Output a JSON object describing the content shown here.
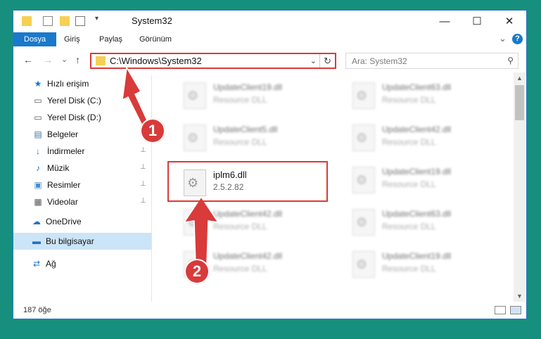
{
  "window": {
    "title": "System32",
    "minimize": "—",
    "maximize": "☐",
    "close": "✕"
  },
  "ribbon": {
    "tabs": [
      {
        "label": "Dosya"
      },
      {
        "label": "Giriş"
      },
      {
        "label": "Paylaş"
      },
      {
        "label": "Görünüm"
      }
    ],
    "expand_icon": "⌄",
    "help_icon": "?"
  },
  "nav": {
    "back_icon": "←",
    "forward_icon": "→",
    "recent_icon": "⌄",
    "up_icon": "↑",
    "address": "C:\\Windows\\System32",
    "address_dropdown": "⌄",
    "refresh_icon": "↻",
    "search_placeholder": "Ara: System32",
    "search_icon": "⚲"
  },
  "sidebar": {
    "items": [
      {
        "label": "Hızlı erişim",
        "icon": "star-icon",
        "glyph": "★",
        "pinned": false
      },
      {
        "label": "Yerel Disk (C:)",
        "icon": "drive-icon",
        "glyph": "▭",
        "pinned": false
      },
      {
        "label": "Yerel Disk (D:)",
        "icon": "drive-icon",
        "glyph": "▭",
        "pinned": false
      },
      {
        "label": "Belgeler",
        "icon": "documents-icon",
        "glyph": "▤",
        "pinned": true
      },
      {
        "label": "İndirmeler",
        "icon": "download-icon",
        "glyph": "↓",
        "pinned": true
      },
      {
        "label": "Müzik",
        "icon": "music-icon",
        "glyph": "♪",
        "pinned": true
      },
      {
        "label": "Resimler",
        "icon": "pictures-icon",
        "glyph": "▣",
        "pinned": true
      },
      {
        "label": "Videolar",
        "icon": "videos-icon",
        "glyph": "▦",
        "pinned": true
      },
      {
        "label": "OneDrive",
        "icon": "cloud-icon",
        "glyph": "☁",
        "pinned": false
      },
      {
        "label": "Bu bilgisayar",
        "icon": "computer-icon",
        "glyph": "▬",
        "pinned": false
      },
      {
        "label": "Ağ",
        "icon": "network-icon",
        "glyph": "⇄",
        "pinned": false
      }
    ],
    "pin_glyph": "📌"
  },
  "files": {
    "highlighted": {
      "name": "iplm6.dll",
      "desc": "2.5.2.82"
    },
    "others": [
      {
        "name": "UpdateClient19.dll",
        "desc": "Resource DLL"
      },
      {
        "name": "UpdateClient63.dll",
        "desc": "Resource DLL"
      },
      {
        "name": "UpdateClient5.dll",
        "desc": "Resource DLL"
      },
      {
        "name": "UpdateClient42.dll",
        "desc": "Resource DLL"
      },
      {
        "name": "UpdateClient19.dll",
        "desc": "Resource DLL"
      },
      {
        "name": "UpdateClient42.dll",
        "desc": "Resource DLL"
      },
      {
        "name": "UpdateClient63.dll",
        "desc": "Resource DLL"
      },
      {
        "name": "UpdateClient42.dll",
        "desc": "Resource DLL"
      },
      {
        "name": "UpdateClient19.dll",
        "desc": "Resource DLL"
      }
    ]
  },
  "status": {
    "count": "187 öğe"
  },
  "annotations": {
    "step1": "1",
    "step2": "2",
    "color": "#d93a3a"
  }
}
